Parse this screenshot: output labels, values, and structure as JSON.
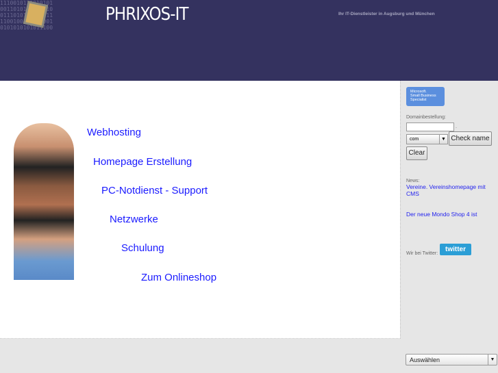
{
  "header": {
    "title": "PHRIXOS-IT",
    "tagline": "Ihr IT-Dienstleister in Augsburg und München",
    "binary": "1110010111010101\n0011010101110010\n0111010110101011\n1100100100101001\n0101010101011100"
  },
  "nav": [
    "Webhosting",
    "Homepage Erstellung",
    "PC-Notdienst - Support",
    "Netzwerke",
    "Schulung",
    "Zum Onlineshop"
  ],
  "sidebar": {
    "badge": {
      "line1": "Microsoft.",
      "line2": "Small Business",
      "line3": "Specialist"
    },
    "domain_label": "Domainbestellung:",
    "domain_value": "",
    "dot": ".",
    "tld": "com",
    "check_label": "Check name",
    "clear_label": "Clear",
    "news_label": "News:",
    "news": [
      "Vereine. Vereinshomepage mit CMS",
      "Der neue Mondo Shop 4 ist"
    ],
    "twitter_label": "Wir bei Twitter:",
    "twitter_button": "twitter"
  },
  "footer": {
    "select": "Auswählen"
  },
  "colors": {
    "header": "#34325f",
    "link": "#1a1aff",
    "sidebar": "#e6e6e6"
  }
}
